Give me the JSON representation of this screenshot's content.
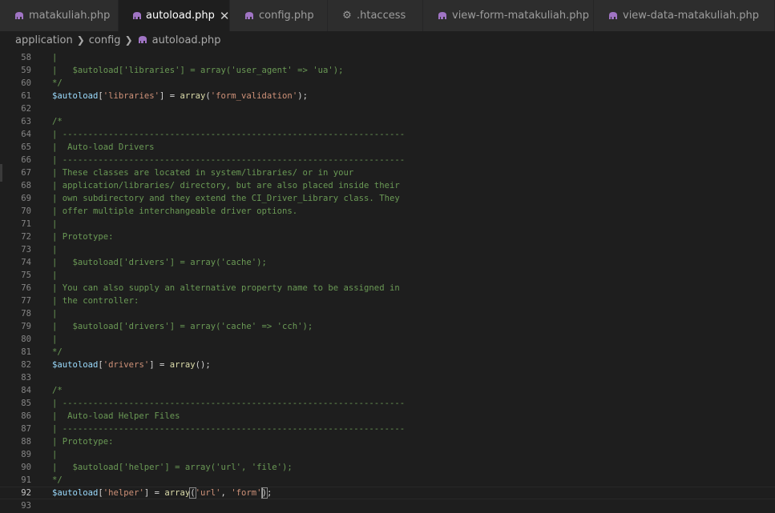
{
  "tabs": [
    {
      "label": "matakuliah.php",
      "icon": "php-elephant-icon",
      "active": false,
      "width": 148
    },
    {
      "label": "autoload.php",
      "icon": "php-elephant-icon",
      "active": true,
      "width": 139
    },
    {
      "label": "config.php",
      "icon": "php-elephant-icon",
      "active": false,
      "width": 122
    },
    {
      "label": ".htaccess",
      "icon": "gear-icon",
      "active": false,
      "width": 119
    },
    {
      "label": "view-form-matakuliah.php",
      "icon": "php-elephant-icon",
      "active": false,
      "width": 213
    },
    {
      "label": "view-data-matakuliah.php",
      "icon": "php-elephant-icon",
      "active": false,
      "width": 226
    }
  ],
  "breadcrumb": {
    "items": [
      "application",
      "config",
      "autoload.php"
    ]
  },
  "colors": {
    "comment": "#6a9955",
    "variable": "#9cdcfe",
    "string": "#ce9178",
    "function": "#dcdcaa",
    "php_icon": "#a074c4"
  },
  "editor": {
    "current_line": 92,
    "lines": [
      {
        "n": "58",
        "t": [
          [
            "cm",
            "|"
          ]
        ]
      },
      {
        "n": "59",
        "t": [
          [
            "cm",
            "|   $autoload['libraries'] = array('user_agent' => 'ua');"
          ]
        ]
      },
      {
        "n": "60",
        "t": [
          [
            "cm",
            "*/"
          ]
        ]
      },
      {
        "n": "61",
        "t": [
          [
            "vr",
            "$autoload"
          ],
          [
            "pn",
            "["
          ],
          [
            "st",
            "'libraries'"
          ],
          [
            "pn",
            "] = "
          ],
          [
            "fn",
            "array"
          ],
          [
            "pn",
            "("
          ],
          [
            "st",
            "'form_validation'"
          ],
          [
            "pn",
            ");"
          ]
        ]
      },
      {
        "n": "62",
        "t": []
      },
      {
        "n": "63",
        "t": [
          [
            "cm",
            "/*"
          ]
        ]
      },
      {
        "n": "64",
        "t": [
          [
            "cm",
            "| -------------------------------------------------------------------"
          ]
        ]
      },
      {
        "n": "65",
        "t": [
          [
            "cm",
            "|  Auto-load Drivers"
          ]
        ]
      },
      {
        "n": "66",
        "t": [
          [
            "cm",
            "| -------------------------------------------------------------------"
          ]
        ]
      },
      {
        "n": "67",
        "t": [
          [
            "cm",
            "| These classes are located in system/libraries/ or in your"
          ]
        ]
      },
      {
        "n": "68",
        "t": [
          [
            "cm",
            "| application/libraries/ directory, but are also placed inside their"
          ]
        ]
      },
      {
        "n": "69",
        "t": [
          [
            "cm",
            "| own subdirectory and they extend the CI_Driver_Library class. They"
          ]
        ]
      },
      {
        "n": "70",
        "t": [
          [
            "cm",
            "| offer multiple interchangeable driver options."
          ]
        ]
      },
      {
        "n": "71",
        "t": [
          [
            "cm",
            "|"
          ]
        ]
      },
      {
        "n": "72",
        "t": [
          [
            "cm",
            "| Prototype:"
          ]
        ]
      },
      {
        "n": "73",
        "t": [
          [
            "cm",
            "|"
          ]
        ]
      },
      {
        "n": "74",
        "t": [
          [
            "cm",
            "|   $autoload['drivers'] = array('cache');"
          ]
        ]
      },
      {
        "n": "75",
        "t": [
          [
            "cm",
            "|"
          ]
        ]
      },
      {
        "n": "76",
        "t": [
          [
            "cm",
            "| You can also supply an alternative property name to be assigned in"
          ]
        ]
      },
      {
        "n": "77",
        "t": [
          [
            "cm",
            "| the controller:"
          ]
        ]
      },
      {
        "n": "78",
        "t": [
          [
            "cm",
            "|"
          ]
        ]
      },
      {
        "n": "79",
        "t": [
          [
            "cm",
            "|   $autoload['drivers'] = array('cache' => 'cch');"
          ]
        ]
      },
      {
        "n": "80",
        "t": [
          [
            "cm",
            "|"
          ]
        ]
      },
      {
        "n": "81",
        "t": [
          [
            "cm",
            "*/"
          ]
        ]
      },
      {
        "n": "82",
        "t": [
          [
            "vr",
            "$autoload"
          ],
          [
            "pn",
            "["
          ],
          [
            "st",
            "'drivers'"
          ],
          [
            "pn",
            "] = "
          ],
          [
            "fn",
            "array"
          ],
          [
            "pn",
            "();"
          ]
        ]
      },
      {
        "n": "83",
        "t": []
      },
      {
        "n": "84",
        "t": [
          [
            "cm",
            "/*"
          ]
        ]
      },
      {
        "n": "85",
        "t": [
          [
            "cm",
            "| -------------------------------------------------------------------"
          ]
        ]
      },
      {
        "n": "86",
        "t": [
          [
            "cm",
            "|  Auto-load Helper Files"
          ]
        ]
      },
      {
        "n": "87",
        "t": [
          [
            "cm",
            "| -------------------------------------------------------------------"
          ]
        ]
      },
      {
        "n": "88",
        "t": [
          [
            "cm",
            "| Prototype:"
          ]
        ]
      },
      {
        "n": "89",
        "t": [
          [
            "cm",
            "|"
          ]
        ]
      },
      {
        "n": "90",
        "t": [
          [
            "cm",
            "|   $autoload['helper'] = array('url', 'file');"
          ]
        ]
      },
      {
        "n": "91",
        "t": [
          [
            "cm",
            "*/"
          ]
        ]
      },
      {
        "n": "92",
        "t": [
          [
            "vr",
            "$autoload"
          ],
          [
            "pn",
            "["
          ],
          [
            "st",
            "'helper'"
          ],
          [
            "pn",
            "] = "
          ],
          [
            "fn",
            "array"
          ],
          [
            "bm",
            "("
          ],
          [
            "st",
            "'url'"
          ],
          [
            "pn",
            ", "
          ],
          [
            "st",
            "'form'"
          ],
          [
            "cur",
            ""
          ],
          [
            "bm",
            ")"
          ],
          [
            "pn",
            ";"
          ]
        ]
      },
      {
        "n": "93",
        "t": []
      }
    ]
  }
}
